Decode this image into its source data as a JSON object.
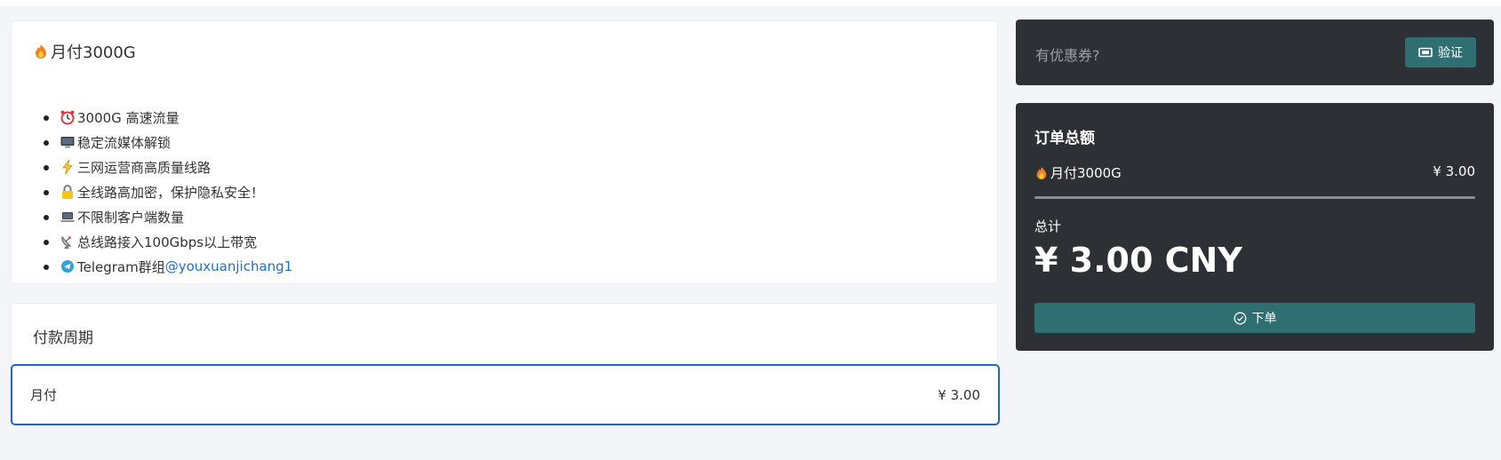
{
  "plan": {
    "title": "月付3000G",
    "title_icon": "fire-icon",
    "features": [
      {
        "icon": "alarm-clock-icon",
        "text": "3000G 高速流量"
      },
      {
        "icon": "monitor-icon",
        "text": "稳定流媒体解锁"
      },
      {
        "icon": "lightning-icon",
        "text": "三网运营商高质量线路"
      },
      {
        "icon": "lock-icon",
        "text": "全线路高加密，保护隐私安全！"
      },
      {
        "icon": "laptop-icon",
        "text": "不限制客户端数量"
      },
      {
        "icon": "satellite-dish-icon",
        "text": "总线路接入100Gbps以上带宽"
      },
      {
        "icon": "telegram-icon",
        "text": "Telegram群组",
        "link": "@youxuanjichang1"
      }
    ]
  },
  "billing": {
    "title": "付款周期",
    "option_label": "月付",
    "option_price": "¥ 3.00"
  },
  "coupon": {
    "placeholder": "有优惠券?",
    "verify_label": "验证"
  },
  "summary": {
    "title": "订单总额",
    "item_label": "月付3000G",
    "item_price": "¥ 3.00",
    "total_label": "总计",
    "total_amount": "¥ 3.00 CNY",
    "order_label": "下单"
  },
  "colors": {
    "accent": "#2f6f72",
    "selected_border": "#1c65c9",
    "dark_panel": "#2d3034",
    "link": "#1f6fd1"
  }
}
